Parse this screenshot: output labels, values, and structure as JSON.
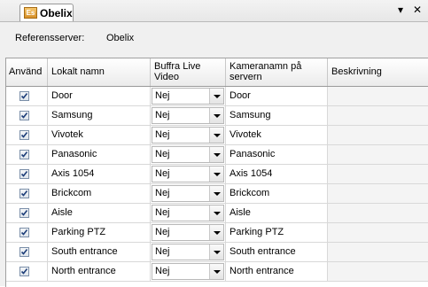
{
  "window": {
    "tab_title": "Obelix",
    "tab_icon_text": "Es",
    "menu_glyph": "▾",
    "close_glyph": "✕"
  },
  "reference": {
    "label": "Referensserver:",
    "value": "Obelix"
  },
  "table": {
    "headers": [
      "Använd",
      "Lokalt namn",
      "Buffra Live Video",
      "Kameranamn på servern",
      "Beskrivning"
    ],
    "rows": [
      {
        "enabled": true,
        "local_name": "Door",
        "buffer": "Nej",
        "server_name": "Door",
        "description": ""
      },
      {
        "enabled": true,
        "local_name": "Samsung",
        "buffer": "Nej",
        "server_name": "Samsung",
        "description": ""
      },
      {
        "enabled": true,
        "local_name": "Vivotek",
        "buffer": "Nej",
        "server_name": "Vivotek",
        "description": ""
      },
      {
        "enabled": true,
        "local_name": "Panasonic",
        "buffer": "Nej",
        "server_name": "Panasonic",
        "description": ""
      },
      {
        "enabled": true,
        "local_name": "Axis 1054",
        "buffer": "Nej",
        "server_name": "Axis 1054",
        "description": ""
      },
      {
        "enabled": true,
        "local_name": "Brickcom",
        "buffer": "Nej",
        "server_name": "Brickcom",
        "description": ""
      },
      {
        "enabled": true,
        "local_name": "Aisle",
        "buffer": "Nej",
        "server_name": "Aisle",
        "description": ""
      },
      {
        "enabled": true,
        "local_name": "Parking PTZ",
        "buffer": "Nej",
        "server_name": "Parking PTZ",
        "description": ""
      },
      {
        "enabled": true,
        "local_name": "South entrance",
        "buffer": "Nej",
        "server_name": "South entrance",
        "description": ""
      },
      {
        "enabled": true,
        "local_name": "North entrance",
        "buffer": "Nej",
        "server_name": "North entrance",
        "description": ""
      }
    ]
  }
}
